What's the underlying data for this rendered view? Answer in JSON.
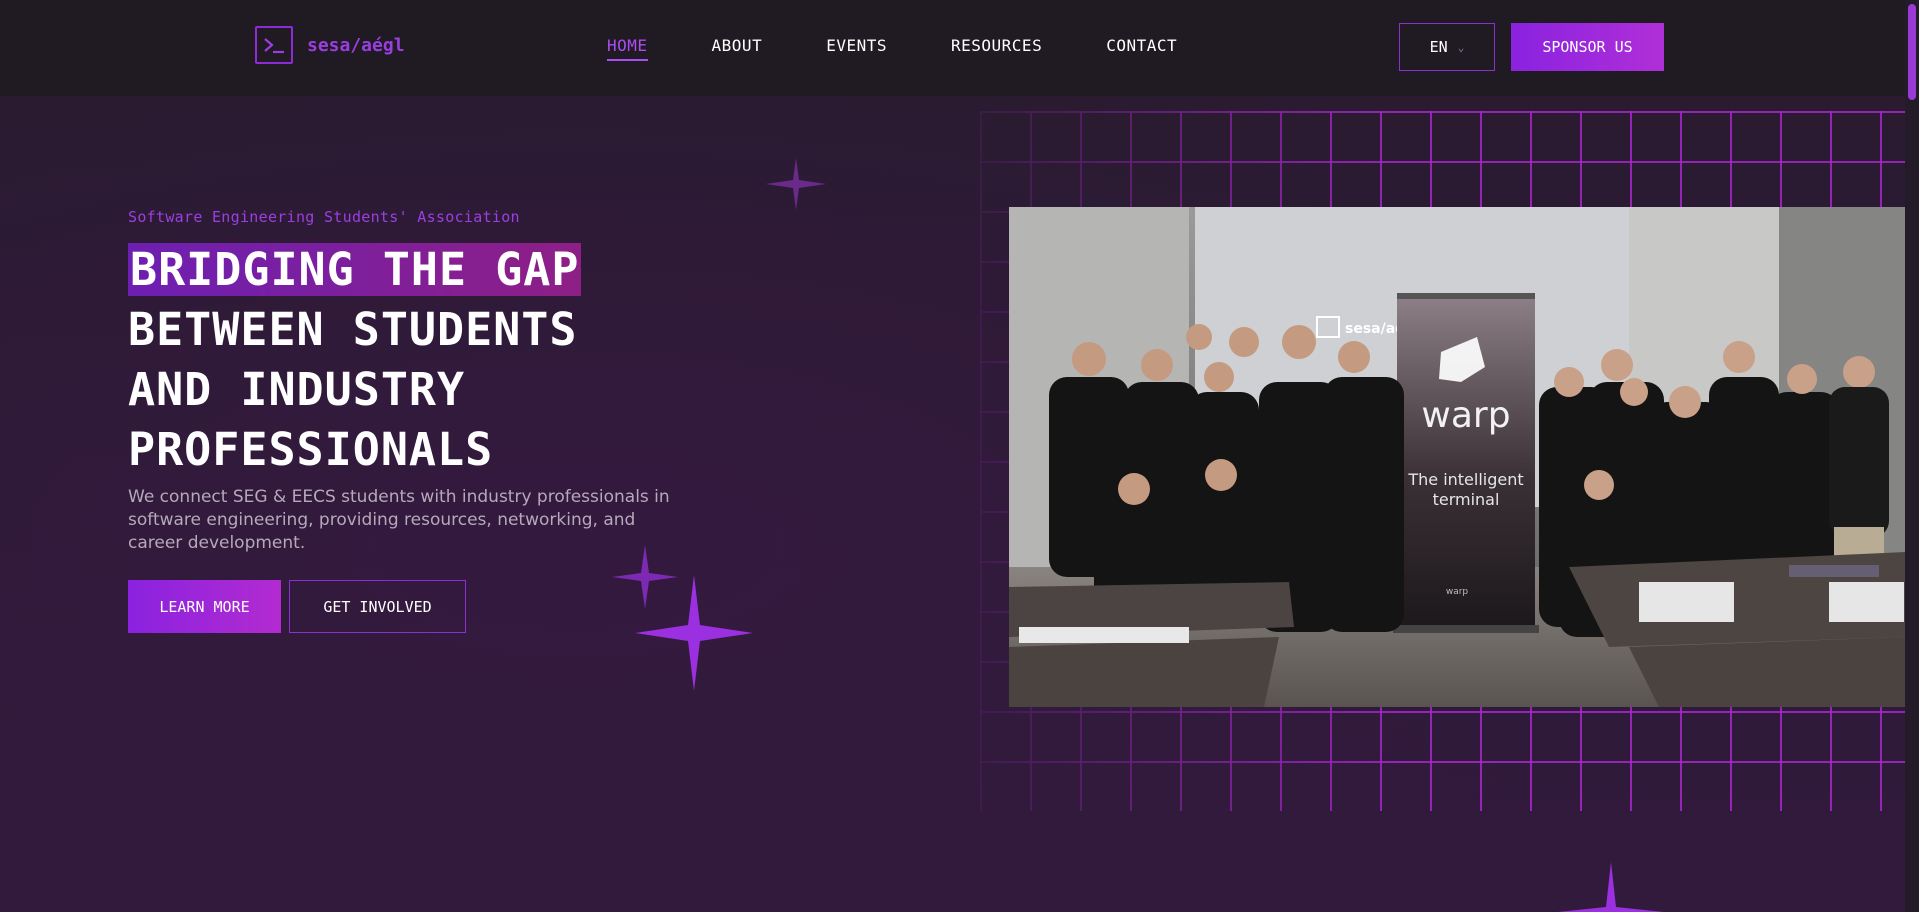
{
  "header": {
    "logo_text": "sesa/aégl",
    "nav": [
      {
        "label": "HOME",
        "active": true
      },
      {
        "label": "ABOUT",
        "active": false
      },
      {
        "label": "EVENTS",
        "active": false
      },
      {
        "label": "RESOURCES",
        "active": false
      },
      {
        "label": "CONTACT",
        "active": false
      }
    ],
    "language": "EN",
    "sponsor_label": "SPONSOR US"
  },
  "hero": {
    "tagline": "Software Engineering Students' Association",
    "headline_lines": [
      "BRIDGING THE GAP",
      "BETWEEN STUDENTS",
      "AND INDUSTRY",
      "PROFESSIONALS"
    ],
    "description": "We connect SEG & EECS students with industry professionals in software engineering, providing resources, networking, and career development.",
    "primary_button": "LEARN MORE",
    "secondary_button": "GET INVOLVED"
  },
  "photo": {
    "screen_text": "sesa/aé",
    "banner_brand": "warp",
    "banner_tagline": "The intelligent terminal",
    "banner_footer": "warp"
  },
  "colors": {
    "accent": "#9b3fe0",
    "accent_gradient_end": "#b02fd8",
    "background": "#2b1b33",
    "header_bg": "#201a22",
    "grid_line": "#a826cd"
  },
  "icons": {
    "logo": "terminal-prompt-icon",
    "language_caret": "chevron-down-icon",
    "decor": "sparkle-icon"
  }
}
